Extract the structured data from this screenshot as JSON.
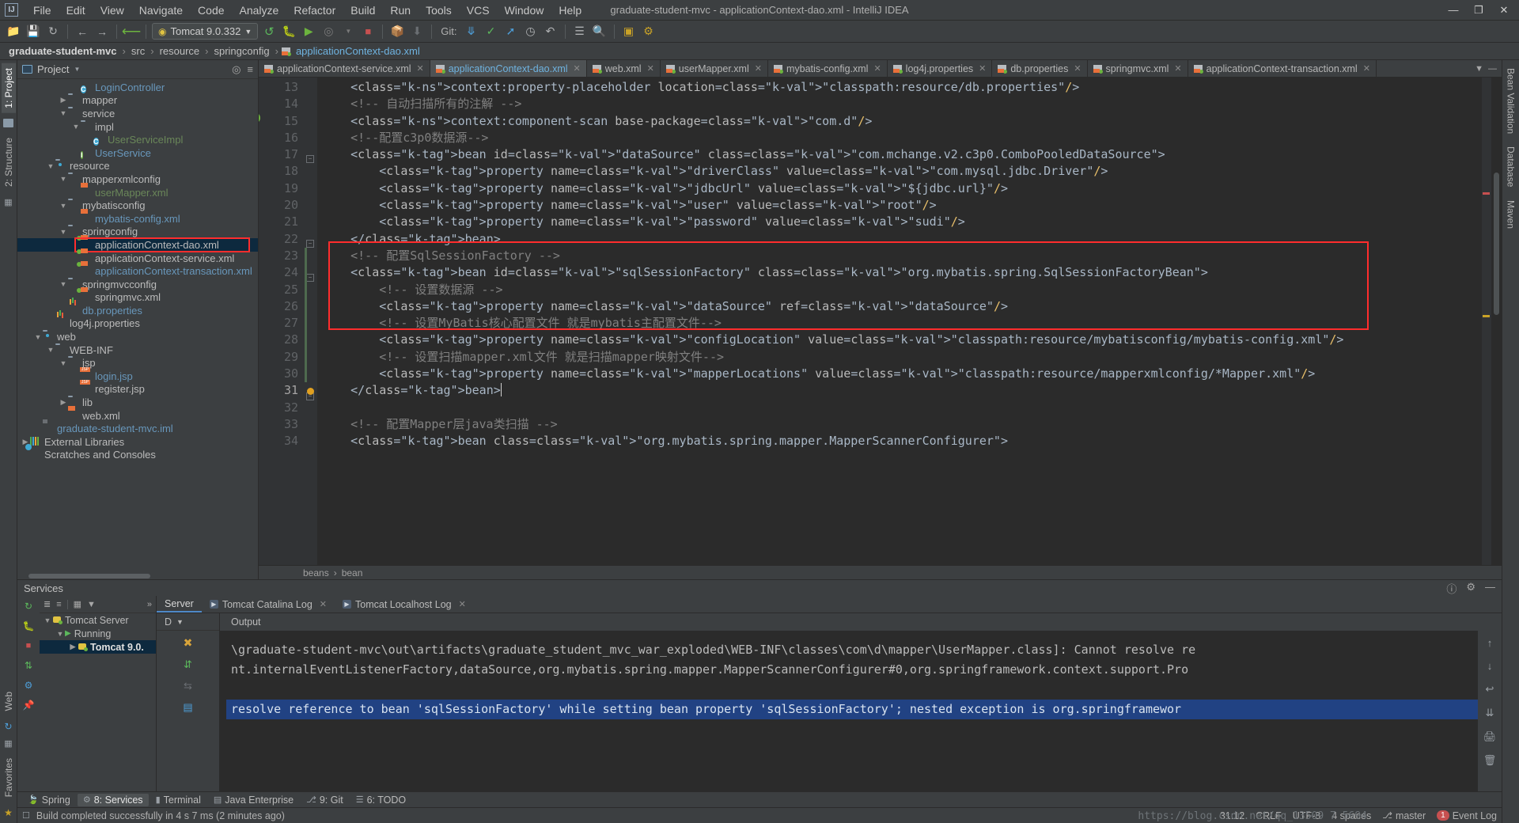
{
  "window": {
    "title": "graduate-student-mvc - applicationContext-dao.xml - IntelliJ IDEA",
    "logo": "IJ",
    "minimize": "—",
    "maximize": "❐",
    "close": "✕"
  },
  "menu": [
    "File",
    "Edit",
    "View",
    "Navigate",
    "Code",
    "Analyze",
    "Refactor",
    "Build",
    "Run",
    "Tools",
    "VCS",
    "Window",
    "Help"
  ],
  "toolbar": {
    "run_config": "Tomcat 9.0.332",
    "git_label": "Git:",
    "icons": [
      "open-icon",
      "save-icon",
      "sync-icon",
      "back-icon",
      "forward-icon",
      "jump-icon",
      "run-icon",
      "debug-icon",
      "run-coverage-icon",
      "profile-icon",
      "stop-icon",
      "build-icon",
      "build-download-icon",
      "update-project-icon",
      "commit-icon",
      "push-icon",
      "history-icon",
      "rollback-icon",
      "search-everywhere-icon",
      "settings-icon",
      "structure-icon",
      "bookmark-icon"
    ]
  },
  "breadcrumb": {
    "project": "graduate-student-mvc",
    "parts": [
      "src",
      "resource",
      "springconfig"
    ],
    "file": "applicationContext-dao.xml"
  },
  "left_strip": [
    "1: Project",
    "2: Structure"
  ],
  "right_strip": [
    "Bean Validation",
    "Database",
    "Maven"
  ],
  "bottom_left_strip": [
    "Web",
    "Favorites"
  ],
  "project_panel": {
    "title": "Project",
    "tree": [
      {
        "indent": 4,
        "arrow": "",
        "icon": "class-icon",
        "label": "LoginController",
        "color": "blue"
      },
      {
        "indent": 3,
        "arrow": "▶",
        "icon": "folder-icon",
        "label": "mapper",
        "color": ""
      },
      {
        "indent": 3,
        "arrow": "▼",
        "icon": "folder-icon",
        "label": "service",
        "color": ""
      },
      {
        "indent": 4,
        "arrow": "▼",
        "icon": "folder-icon",
        "label": "impl",
        "color": ""
      },
      {
        "indent": 5,
        "arrow": "",
        "icon": "class-icon",
        "label": "UserServiceImpl",
        "color": "green"
      },
      {
        "indent": 4,
        "arrow": "",
        "icon": "interface-icon",
        "label": "UserService",
        "color": "blue"
      },
      {
        "indent": 2,
        "arrow": "▼",
        "icon": "source-folder-icon",
        "label": "resource",
        "color": ""
      },
      {
        "indent": 3,
        "arrow": "▼",
        "icon": "folder-icon",
        "label": "mapperxmlconfig",
        "color": ""
      },
      {
        "indent": 4,
        "arrow": "",
        "icon": "xml-icon",
        "label": "userMapper.xml",
        "color": "green"
      },
      {
        "indent": 3,
        "arrow": "▼",
        "icon": "folder-icon",
        "label": "mybatisconfig",
        "color": ""
      },
      {
        "indent": 4,
        "arrow": "",
        "icon": "xml-icon",
        "label": "mybatis-config.xml",
        "color": "blue"
      },
      {
        "indent": 3,
        "arrow": "▼",
        "icon": "folder-icon",
        "label": "springconfig",
        "color": ""
      },
      {
        "indent": 4,
        "arrow": "",
        "icon": "spring-xml-icon",
        "label": "applicationContext-dao.xml",
        "color": "",
        "selected": true
      },
      {
        "indent": 4,
        "arrow": "",
        "icon": "spring-xml-icon",
        "label": "applicationContext-service.xml",
        "color": ""
      },
      {
        "indent": 4,
        "arrow": "",
        "icon": "spring-xml-icon",
        "label": "applicationContext-transaction.xml",
        "color": "blue"
      },
      {
        "indent": 3,
        "arrow": "▼",
        "icon": "folder-icon",
        "label": "springmvcconfig",
        "color": ""
      },
      {
        "indent": 4,
        "arrow": "",
        "icon": "spring-xml-icon",
        "label": "springmvc.xml",
        "color": ""
      },
      {
        "indent": 3,
        "arrow": "",
        "icon": "properties-icon",
        "label": "db.properties",
        "color": "blue"
      },
      {
        "indent": 2,
        "arrow": "",
        "icon": "properties-icon",
        "label": "log4j.properties",
        "color": ""
      },
      {
        "indent": 1,
        "arrow": "▼",
        "icon": "source-folder-icon",
        "label": "web",
        "color": ""
      },
      {
        "indent": 2,
        "arrow": "▼",
        "icon": "folder-icon",
        "label": "WEB-INF",
        "color": ""
      },
      {
        "indent": 3,
        "arrow": "▼",
        "icon": "folder-icon",
        "label": "jsp",
        "color": ""
      },
      {
        "indent": 4,
        "arrow": "",
        "icon": "jsp-icon",
        "label": "login.jsp",
        "color": "blue"
      },
      {
        "indent": 4,
        "arrow": "",
        "icon": "jsp-icon",
        "label": "register.jsp",
        "color": ""
      },
      {
        "indent": 3,
        "arrow": "▶",
        "icon": "folder-icon",
        "label": "lib",
        "color": ""
      },
      {
        "indent": 3,
        "arrow": "",
        "icon": "xml-icon",
        "label": "web.xml",
        "color": ""
      },
      {
        "indent": 1,
        "arrow": "",
        "icon": "iml-icon",
        "label": "graduate-student-mvc.iml",
        "color": "blue"
      },
      {
        "indent": 0,
        "arrow": "▶",
        "icon": "library-icon",
        "label": "External Libraries",
        "color": ""
      },
      {
        "indent": 0,
        "arrow": "",
        "icon": "scratches-icon",
        "label": "Scratches and Consoles",
        "color": ""
      }
    ]
  },
  "editor_tabs": [
    {
      "label": "applicationContext-service.xml",
      "active": false
    },
    {
      "label": "applicationContext-dao.xml",
      "active": true
    },
    {
      "label": "web.xml",
      "active": false
    },
    {
      "label": "userMapper.xml",
      "active": false
    },
    {
      "label": "mybatis-config.xml",
      "active": false
    },
    {
      "label": "log4j.properties",
      "active": false
    },
    {
      "label": "db.properties",
      "active": false
    },
    {
      "label": "springmvc.xml",
      "active": false
    },
    {
      "label": "applicationContext-transaction.xml",
      "active": false
    }
  ],
  "editor": {
    "first_line": 13,
    "lines": [
      {
        "n": 13,
        "text": "    <context:property-placeholder location=\"classpath:resource/db.properties\"/>"
      },
      {
        "n": 14,
        "text": "    <!-- 自动扫描所有的注解 -->"
      },
      {
        "n": 15,
        "text": "    <context:component-scan base-package=\"com.d\"/>"
      },
      {
        "n": 16,
        "text": "    <!--配置c3p0数据源-->"
      },
      {
        "n": 17,
        "text": "    <bean id=\"dataSource\" class=\"com.mchange.v2.c3p0.ComboPooledDataSource\">"
      },
      {
        "n": 18,
        "text": "        <property name=\"driverClass\" value=\"com.mysql.jdbc.Driver\"/>"
      },
      {
        "n": 19,
        "text": "        <property name=\"jdbcUrl\" value=\"${jdbc.url}\"/>"
      },
      {
        "n": 20,
        "text": "        <property name=\"user\" value=\"root\"/>"
      },
      {
        "n": 21,
        "text": "        <property name=\"password\" value=\"sudi\"/>"
      },
      {
        "n": 22,
        "text": "    </bean>"
      },
      {
        "n": 23,
        "text": "    <!-- 配置SqlSessionFactory -->"
      },
      {
        "n": 24,
        "text": "    <bean id=\"sqlSessionFactory\" class=\"org.mybatis.spring.SqlSessionFactoryBean\">"
      },
      {
        "n": 25,
        "text": "        <!-- 设置数据源 -->"
      },
      {
        "n": 26,
        "text": "        <property name=\"dataSource\" ref=\"dataSource\"/>"
      },
      {
        "n": 27,
        "text": "        <!-- 设置MyBatis核心配置文件 就是mybatis主配置文件-->"
      },
      {
        "n": 28,
        "text": "        <property name=\"configLocation\" value=\"classpath:resource/mybatisconfig/mybatis-config.xml\"/>"
      },
      {
        "n": 29,
        "text": "        <!-- 设置扫描mapper.xml文件 就是扫描mapper映射文件-->"
      },
      {
        "n": 30,
        "text": "        <property name=\"mapperLocations\" value=\"classpath:resource/mapperxmlconfig/*Mapper.xml\"/>"
      },
      {
        "n": 31,
        "text": "    </bean>"
      },
      {
        "n": 32,
        "text": ""
      },
      {
        "n": 33,
        "text": "    <!-- 配置Mapper层java类扫描 -->"
      },
      {
        "n": 34,
        "text": "    <bean class=\"org.mybatis.spring.mapper.MapperScannerConfigurer\">"
      }
    ],
    "cursor_line": 31,
    "breadcrumb": [
      "beans",
      "bean"
    ],
    "highlight_box_color": "#ff2d2d"
  },
  "services": {
    "title": "Services",
    "tree": [
      {
        "indent": 0,
        "arrow": "▼",
        "label": "Tomcat Server",
        "icon": "tomcat-icon",
        "selected": false
      },
      {
        "indent": 1,
        "arrow": "▼",
        "label": "Running",
        "icon": "run-green-icon",
        "selected": false
      },
      {
        "indent": 2,
        "arrow": "▶",
        "label": "Tomcat 9.0.",
        "icon": "tomcat-icon",
        "selected": true
      }
    ],
    "tabs": [
      {
        "label": "Server",
        "active": true,
        "icon": ""
      },
      {
        "label": "Tomcat Catalina Log",
        "active": false,
        "icon": "run-icon"
      },
      {
        "label": "Tomcat Localhost Log",
        "active": false,
        "icon": "run-icon"
      }
    ],
    "dropdown_label": "D",
    "output_tab": "Output",
    "console_lines": [
      {
        "text": "\\graduate-student-mvc\\out\\artifacts\\graduate_student_mvc_war_exploded\\WEB-INF\\classes\\com\\d\\mapper\\UserMapper.class]: Cannot resolve re",
        "highlight": false
      },
      {
        "text": "nt.internalEventListenerFactory,dataSource,org.mybatis.spring.mapper.MapperScannerConfigurer#0,org.springframework.context.support.Pro",
        "highlight": false
      },
      {
        "text": "",
        "highlight": false
      },
      {
        "text": "resolve reference to bean 'sqlSessionFactory' while setting bean property 'sqlSessionFactory'; nested exception is org.springframewor",
        "highlight": true
      }
    ]
  },
  "tool_windows": [
    {
      "label": "Spring",
      "icon": "spring-icon",
      "active": false
    },
    {
      "label": "8: Services",
      "icon": "services-icon",
      "active": true
    },
    {
      "label": "Terminal",
      "icon": "terminal-icon",
      "active": false
    },
    {
      "label": "Java Enterprise",
      "icon": "java-ee-icon",
      "active": false
    },
    {
      "label": "9: Git",
      "icon": "git-icon",
      "active": false
    },
    {
      "label": "6: TODO",
      "icon": "todo-icon",
      "active": false
    }
  ],
  "status_bar": {
    "message": "Build completed successfully in 4 s 7 ms (2 minutes ago)",
    "position": "31:12",
    "line_sep": "CRLF",
    "encoding": "UTF-8",
    "indent": "4 spaces",
    "branch": "master",
    "event_log": "Event Log",
    "event_count": "1",
    "watermark": "https://blog.csdn.net/qq_13509 7 5694"
  }
}
